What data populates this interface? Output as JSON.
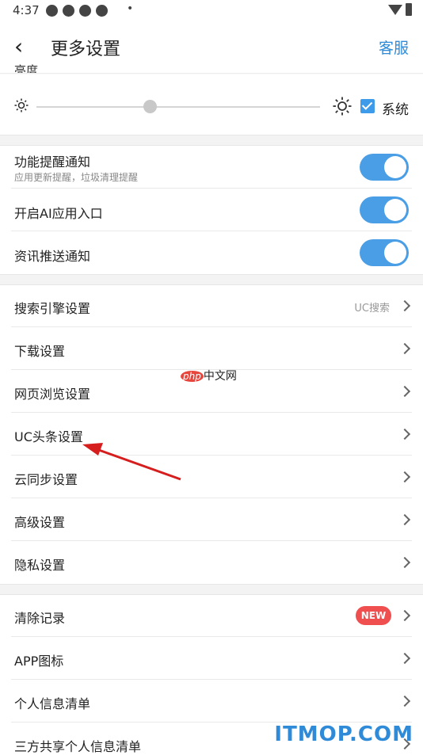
{
  "status_bar": {
    "time": "4:37",
    "dot": "•"
  },
  "header": {
    "back": "‹",
    "title": "更多设置",
    "service": "客服"
  },
  "brightness": {
    "label": "亮度",
    "level": 0.4,
    "system_label": "系统",
    "system_checked": true
  },
  "notifications": [
    {
      "label": "功能提醒通知",
      "sub": "应用更新提醒，垃圾清理提醒",
      "on": true
    },
    {
      "label": "开启AI应用入口",
      "on": true
    },
    {
      "label": "资讯推送通知",
      "on": true
    }
  ],
  "settings": [
    {
      "label": "搜索引擎设置",
      "value": "UC搜索"
    },
    {
      "label": "下载设置"
    },
    {
      "label": "网页浏览设置"
    },
    {
      "label": "UC头条设置"
    },
    {
      "label": "云同步设置"
    },
    {
      "label": "高级设置"
    },
    {
      "label": "隐私设置"
    }
  ],
  "records": [
    {
      "label": "清除记录",
      "badge": "NEW"
    },
    {
      "label": "APP图标"
    },
    {
      "label": "个人信息清单"
    },
    {
      "label": "三方共享个人信息清单"
    }
  ],
  "watermark": {
    "php": "php",
    "cn": "中文网",
    "site": "ITMOP.COM"
  },
  "colors": {
    "accent": "#2f8bd8",
    "toggle": "#4a9ee6",
    "badge": "#f04f4f",
    "arrow": "#d61e1e"
  }
}
